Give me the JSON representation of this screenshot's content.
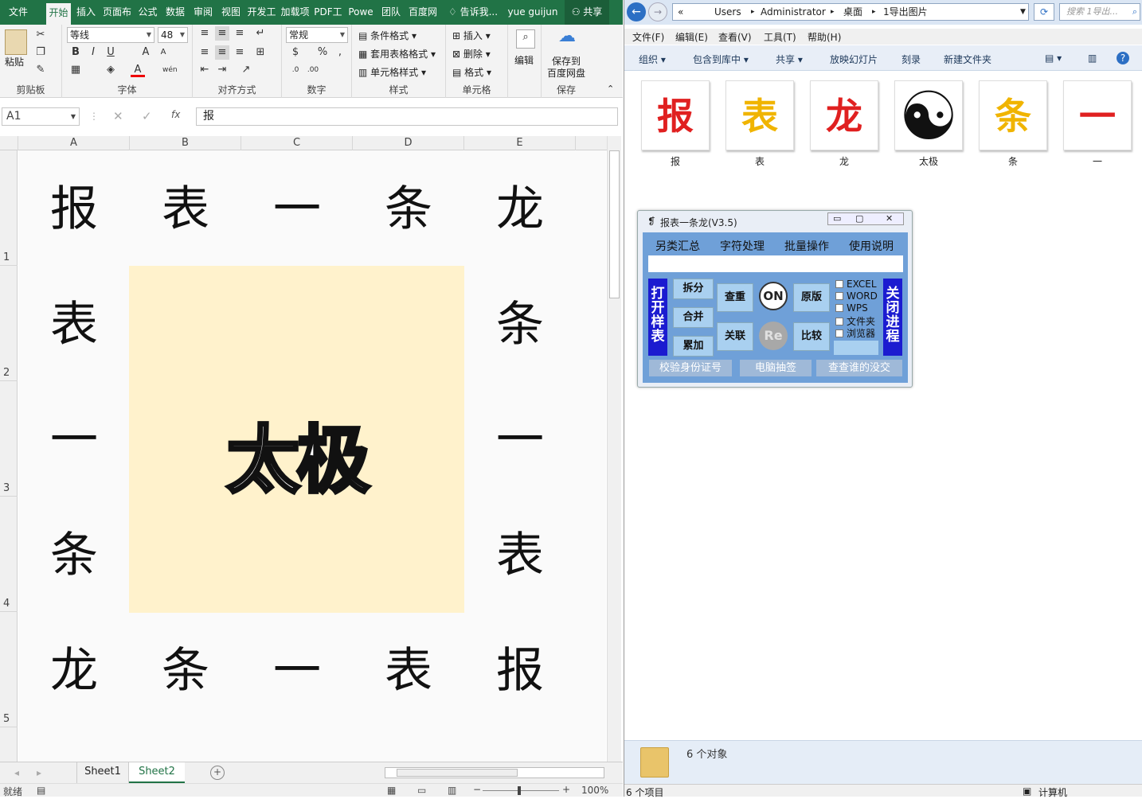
{
  "excel": {
    "ribbon_tabs": [
      "文件",
      "开始",
      "插入",
      "页面布",
      "公式",
      "数据",
      "审阅",
      "视图",
      "开发工",
      "加载项",
      "PDF工",
      "Powe",
      "团队",
      "百度网"
    ],
    "tell_me": "告诉我...",
    "user": "yue guijun",
    "share": "共享",
    "clipboard": {
      "paste": "粘贴",
      "label": "剪贴板"
    },
    "font": {
      "name": "等线",
      "size": "48",
      "label": "字体"
    },
    "alignment": {
      "label": "对齐方式"
    },
    "number": {
      "format": "常规",
      "label": "数字"
    },
    "styles": {
      "conditional": "条件格式",
      "table": "套用表格格式",
      "cell": "单元格样式",
      "label": "样式"
    },
    "cells": {
      "insert": "插入",
      "delete": "删除",
      "format": "格式",
      "label": "单元格"
    },
    "editing": {
      "label": "编辑"
    },
    "save": {
      "line1": "保存到",
      "line2": "百度网盘",
      "label": "保存"
    },
    "name_box": "A1",
    "formula": "报",
    "columns": [
      "A",
      "B",
      "C",
      "D",
      "E"
    ],
    "rows": [
      "1",
      "2",
      "3",
      "4",
      "5"
    ],
    "cells_text": {
      "r1": [
        "报",
        "表",
        "一",
        "条",
        "龙"
      ],
      "r2": [
        "表",
        "条"
      ],
      "r3": [
        "一",
        "一"
      ],
      "r4": [
        "条",
        "表"
      ],
      "r5": [
        "龙",
        "条",
        "一",
        "表",
        "报"
      ]
    },
    "merged_text": "太极",
    "merged_fill": "#fff2cc",
    "sheets": [
      "Sheet1",
      "Sheet2"
    ],
    "active_sheet": "Sheet2",
    "status": "就绪",
    "zoom": "100%",
    "accent": "#217346"
  },
  "explorer": {
    "breadcrumb": [
      "Users",
      "Administrator",
      "桌面",
      "1导出图片"
    ],
    "search_placeholder": "搜索 1导出...",
    "menu": [
      "文件(F)",
      "编辑(E)",
      "查看(V)",
      "工具(T)",
      "帮助(H)"
    ],
    "commands": [
      "组织",
      "包含到库中",
      "共享",
      "放映幻灯片",
      "刻录",
      "新建文件夹"
    ],
    "files": [
      {
        "glyph": "报",
        "label": "报",
        "color": "#e02020"
      },
      {
        "glyph": "表",
        "label": "表",
        "color": "#f0b400"
      },
      {
        "glyph": "龙",
        "label": "龙",
        "color": "#e02020"
      },
      {
        "glyph": "☯",
        "label": "太极",
        "color": "#111111"
      },
      {
        "glyph": "条",
        "label": "条",
        "color": "#f0b400"
      },
      {
        "glyph": "一",
        "label": "一",
        "color": "#e02020"
      }
    ],
    "details_count": "6 个对象",
    "status_items": "6 个项目",
    "status_computer": "计算机"
  },
  "tool": {
    "title": "报表一条龙(V3.5)",
    "menu": [
      "另类汇总",
      "字符处理",
      "批量操作",
      "使用说明"
    ],
    "open_sample": "打开样表",
    "close_process": "关闭进程",
    "split": "拆分",
    "merge": "合并",
    "accumulate": "累加",
    "dedupe": "查重",
    "relate": "关联",
    "on": "ON",
    "re": "Re",
    "original": "原版",
    "compare": "比较",
    "checks": [
      "EXCEL",
      "WORD",
      "WPS",
      "文件夹",
      "浏览器"
    ],
    "bottom": [
      "校验身份证号",
      "电脑抽签",
      "查查谁的没交"
    ]
  }
}
